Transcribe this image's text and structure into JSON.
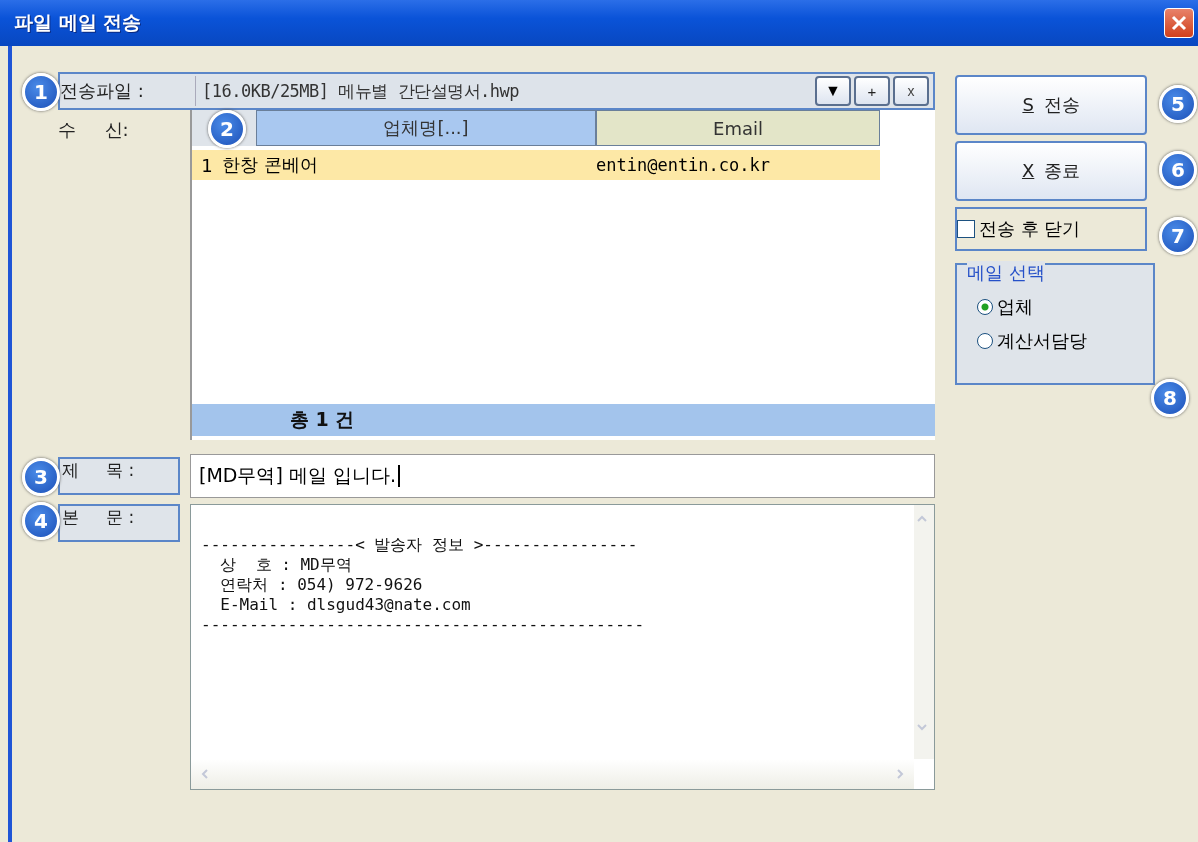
{
  "window": {
    "title": "파일 메일 전송"
  },
  "file": {
    "callout": "1",
    "label": "전송파일 :",
    "value": "[16.0KB/25MB] 메뉴별 간단설명서.hwp",
    "buttons": [
      {
        "kind": "dropdown",
        "text": "▼"
      },
      {
        "kind": "add",
        "text": "+"
      },
      {
        "kind": "remove",
        "text": "x"
      }
    ]
  },
  "recipients": {
    "label": "수     신:",
    "callout": "2",
    "columns": [
      {
        "label": "업체명[...]",
        "color": "#a9c8f0"
      },
      {
        "label": "Email",
        "color": "#e3e5c8"
      }
    ],
    "rows": [
      {
        "number": "1",
        "company": "한창 콘베어",
        "email": "entin@entin.co.kr",
        "selected": true
      }
    ],
    "total": "총 1 건"
  },
  "subject": {
    "callout": "3",
    "label": "제     목 :",
    "value": "[MD무역] 메일 입니다."
  },
  "body": {
    "callout": "4",
    "label": "본     문 :",
    "lines": [
      "----------------< 발송자 정보 >----------------",
      "  상  호 : MD무역",
      "  연락처 : 054) 972-9626",
      "  E-Mail : dlsgud43@nate.com",
      "----------------------------------------------"
    ]
  },
  "actions": [
    {
      "callout": "5",
      "mnemonic": "S",
      "label": "전송"
    },
    {
      "callout": "6",
      "mnemonic": "X",
      "label": "종료"
    }
  ],
  "close_after_send": {
    "callout": "7",
    "label": "전송 후 닫기",
    "checked": false
  },
  "mail_choice": {
    "callout": "8",
    "title": "메일 선택",
    "options": [
      {
        "label": "업체",
        "selected": true
      },
      {
        "label": "계산서담당",
        "selected": false
      }
    ]
  }
}
